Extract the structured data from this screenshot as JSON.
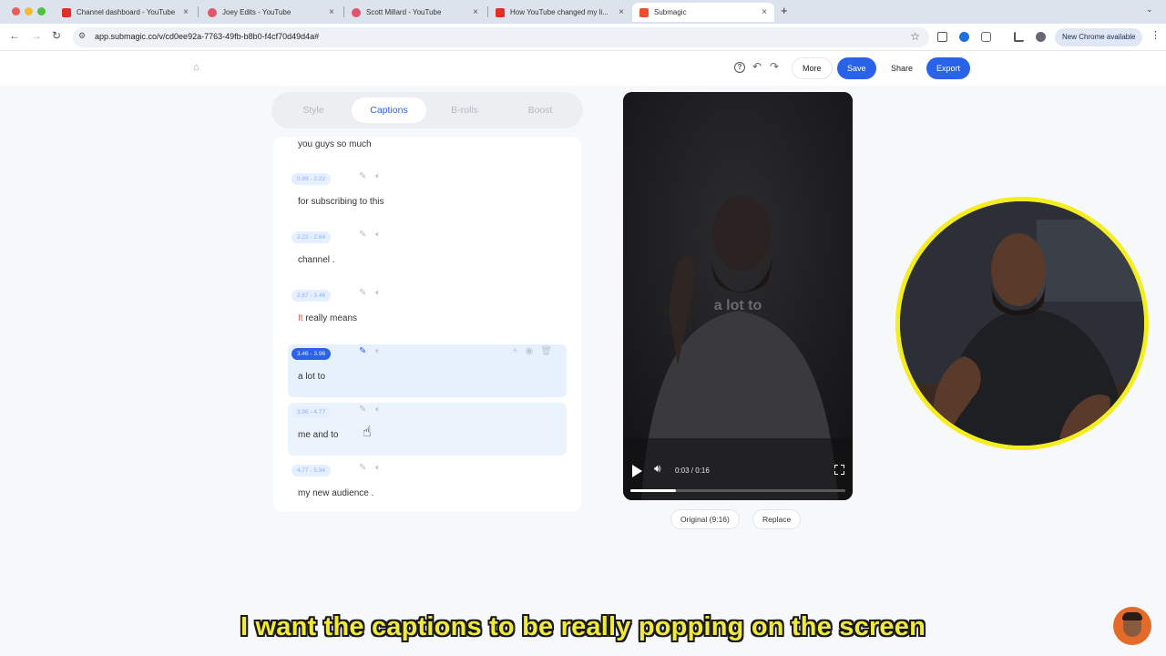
{
  "browser": {
    "tabs": [
      {
        "label": "Channel dashboard - YouTube",
        "favicon_color": "#e52d27"
      },
      {
        "label": "Joey Edits - YouTube",
        "favicon_color": "#e0566d"
      },
      {
        "label": "Scott Millard - YouTube",
        "favicon_color": "#e0566d"
      },
      {
        "label": "How YouTube changed my li...",
        "favicon_color": "#e52d27"
      },
      {
        "label": "Submagic",
        "favicon_color": "#f04f2e",
        "active": true
      }
    ],
    "url": "app.submagic.co/v/cd0ee92a-7763-49fb-b8b0-f4cf70d49d4a#",
    "chrome_update_label": "New Chrome available"
  },
  "toolbar": {
    "more_label": "More",
    "save_label": "Save",
    "share_label": "Share",
    "export_label": "Export"
  },
  "editor_tabs": [
    "Style",
    "Captions",
    "B-rolls",
    "Boost"
  ],
  "active_editor_tab": "Captions",
  "captions": {
    "top_partial_text": "you guys so much",
    "items": [
      {
        "time": "0.99 - 2.22",
        "text": "for subscribing to this"
      },
      {
        "time": "2.22 - 2.64",
        "text": "channel ."
      },
      {
        "time": "2.67 - 3.46",
        "highlight": "It",
        "text": " really means"
      },
      {
        "time": "3.46 - 3.96",
        "text": "a lot to",
        "active": true
      },
      {
        "time": "3.96 - 4.77",
        "text": "me and to",
        "hover": true
      },
      {
        "time": "4.77 - 5.94",
        "text": "my new audience ."
      }
    ]
  },
  "video": {
    "overlay_caption": "a lot to",
    "time_display": "0:03 / 0:16",
    "progress": 0.21,
    "aspect_button": "Original (9:16)",
    "replace_button": "Replace"
  },
  "subtitle": "I want the captions to be really popping on the screen",
  "colors": {
    "accent": "#2b63e8",
    "webcam_border": "#f4ed1f",
    "subtitle": "#f2ea3b"
  }
}
